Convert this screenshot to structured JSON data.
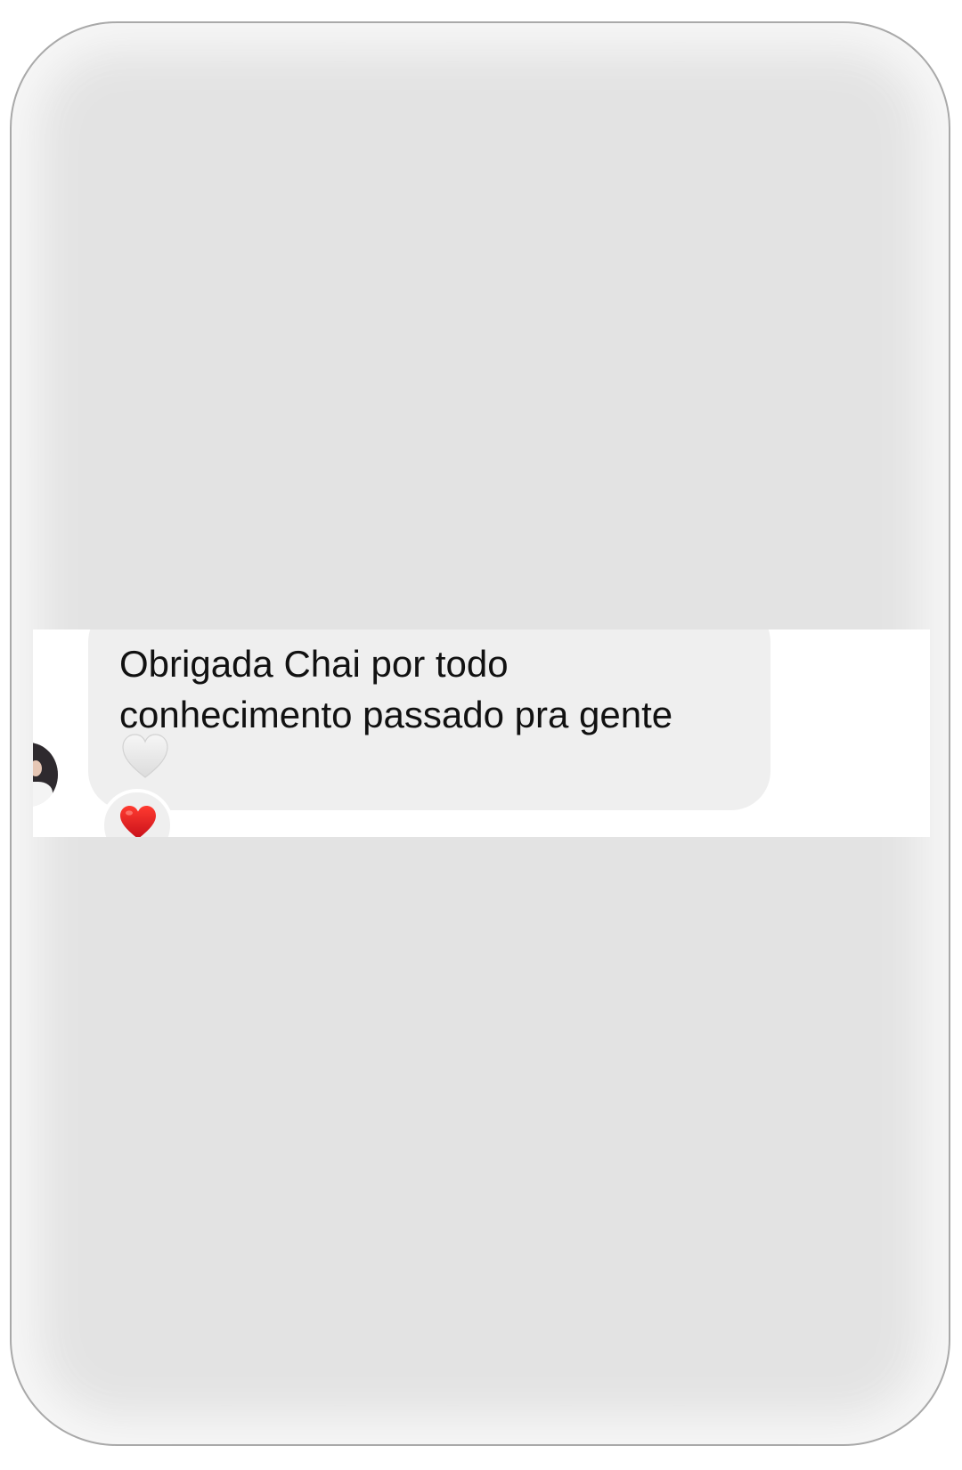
{
  "message": {
    "line1": "Obrigada Chai por todo",
    "line2": "conhecimento passado pra gente",
    "inline_emoji": "white-heart-icon",
    "reaction_emoji": "red-heart-icon"
  },
  "colors": {
    "background": "#e3e3e3",
    "strip": "#ffffff",
    "bubble": "#efefef",
    "text": "#111111",
    "heart_red": "#e0161a",
    "heart_white": "#ececec"
  }
}
